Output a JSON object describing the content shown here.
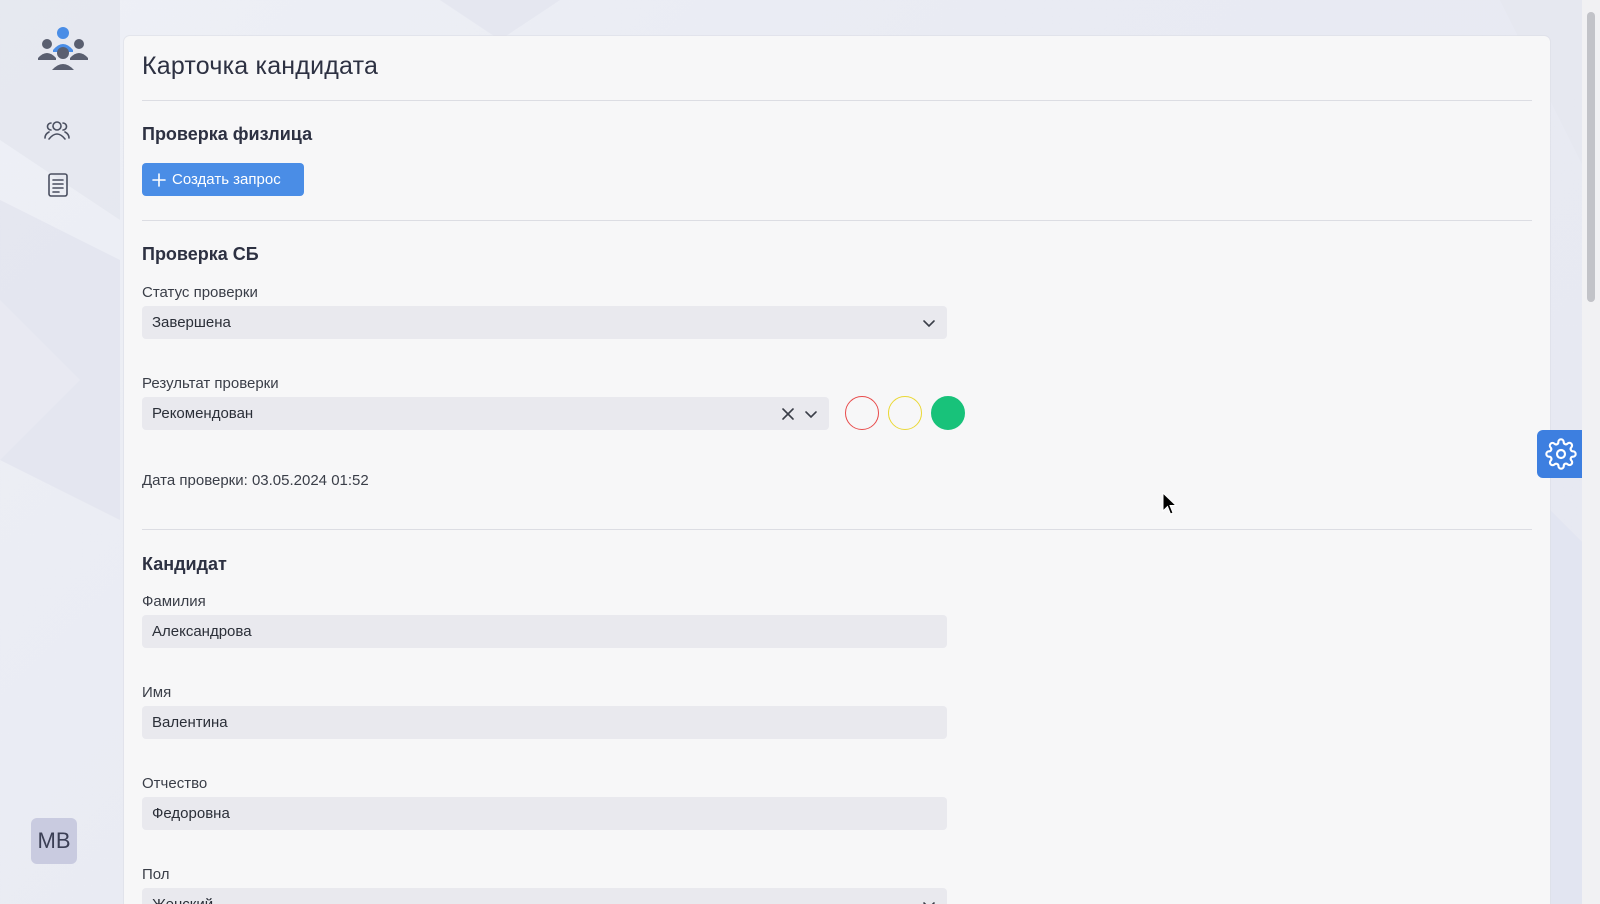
{
  "page": {
    "title": "Карточка кандидата"
  },
  "sections": {
    "individual_check": {
      "title": "Проверка физлица",
      "create_request_label": "Создать запрос"
    },
    "security_check": {
      "title": "Проверка СБ",
      "status_label": "Статус проверки",
      "status_value": "Завершена",
      "result_label": "Результат проверки",
      "result_value": "Рекомендован",
      "result_colors": {
        "red": "#e84b4b",
        "yellow": "#ead835",
        "green": "#18c27a"
      },
      "date_text": "Дата проверки: 03.05.2024 01:52"
    },
    "candidate": {
      "title": "Кандидат",
      "last_name_label": "Фамилия",
      "last_name_value": "Александрова",
      "first_name_label": "Имя",
      "first_name_value": "Валентина",
      "patronymic_label": "Отчество",
      "patronymic_value": "Федоровна",
      "gender_label": "Пол",
      "gender_value": "Женский"
    }
  },
  "sidebar": {
    "logo_icon": "team-logo-icon",
    "items": [
      {
        "icon": "users-icon"
      },
      {
        "icon": "document-list-icon"
      }
    ],
    "avatar_initials": "MB"
  },
  "colors": {
    "primary": "#4a8de6",
    "gear_button": "#3d7fe0"
  }
}
